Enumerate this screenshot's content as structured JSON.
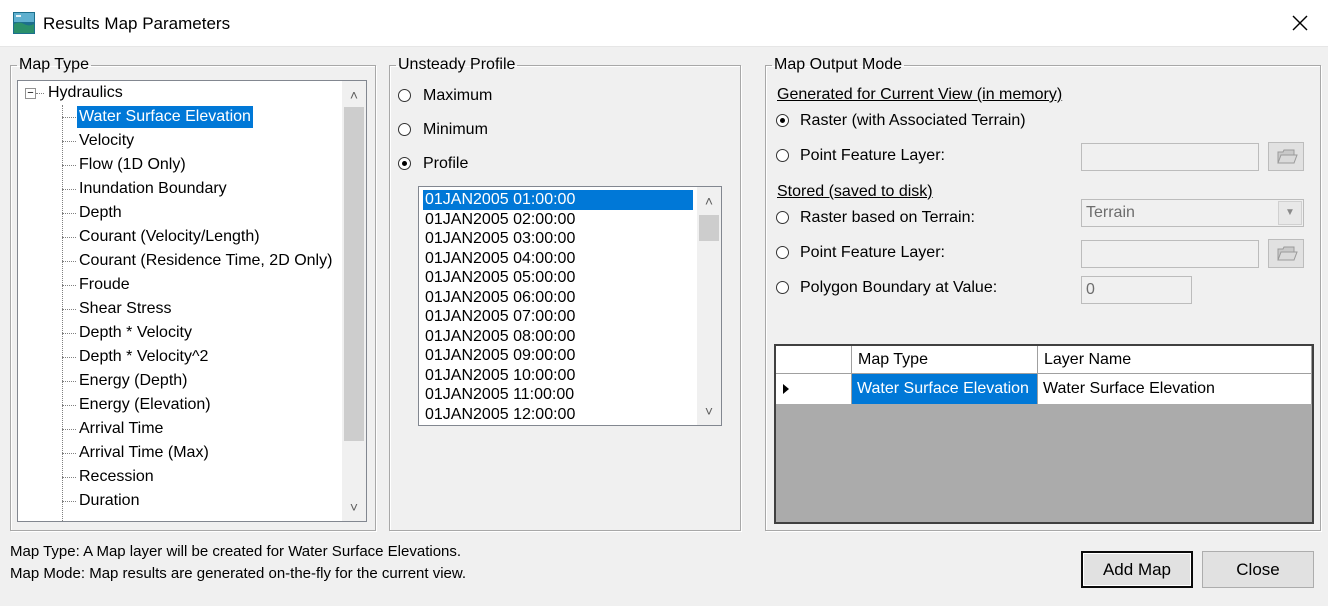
{
  "window": {
    "title": "Results Map Parameters"
  },
  "map_type": {
    "legend": "Map Type",
    "root": "Hydraulics",
    "items": [
      "Water Surface Elevation",
      "Velocity",
      "Flow (1D Only)",
      "Inundation Boundary",
      "Depth",
      "Courant (Velocity/Length)",
      "Courant (Residence Time, 2D Only)",
      "Froude",
      "Shear Stress",
      "Depth * Velocity",
      "Depth * Velocity^2",
      "Energy (Depth)",
      "Energy (Elevation)",
      "Arrival Time",
      "Arrival Time (Max)",
      "Recession",
      "Duration"
    ],
    "selected_index": 0
  },
  "unsteady_profile": {
    "legend": "Unsteady Profile",
    "options": [
      "Maximum",
      "Minimum",
      "Profile"
    ],
    "selected_option": "Profile",
    "profiles": [
      "01JAN2005 01:00:00",
      "01JAN2005 02:00:00",
      "01JAN2005 03:00:00",
      "01JAN2005 04:00:00",
      "01JAN2005 05:00:00",
      "01JAN2005 06:00:00",
      "01JAN2005 07:00:00",
      "01JAN2005 08:00:00",
      "01JAN2005 09:00:00",
      "01JAN2005 10:00:00",
      "01JAN2005 11:00:00",
      "01JAN2005 12:00:00"
    ],
    "selected_profile_index": 0
  },
  "map_output_mode": {
    "legend": "Map Output Mode",
    "generated_heading": "Generated for Current View (in memory)",
    "raster_label": "Raster (with Associated Terrain)",
    "point_layer_label": "Point Feature Layer:",
    "point_layer_value": "",
    "stored_heading": "Stored (saved to disk)",
    "raster_terrain_label": "Raster based on Terrain:",
    "terrain_value": "Terrain",
    "stored_point_label": "Point Feature Layer:",
    "stored_point_value": "",
    "polygon_label": "Polygon Boundary at Value:",
    "polygon_value": "0",
    "selected_mode": "Raster (with Associated Terrain)"
  },
  "layers_table": {
    "columns": [
      "Map Type",
      "Layer Name"
    ],
    "rows": [
      {
        "map_type": "Water Surface Elevation",
        "layer_name": "Water Surface Elevation"
      }
    ]
  },
  "status": {
    "line1": "Map Type: A Map layer will be created for Water Surface Elevations.",
    "line2": "Map Mode: Map results are generated on-the-fly for the current view."
  },
  "buttons": {
    "add_map": "Add Map",
    "close": "Close"
  },
  "icons": {
    "app": "hec-ras-icon",
    "close": "close-icon",
    "browse": "folder-open-icon"
  },
  "colors": {
    "selection": "#0078d7",
    "background": "#f0f0f0"
  }
}
